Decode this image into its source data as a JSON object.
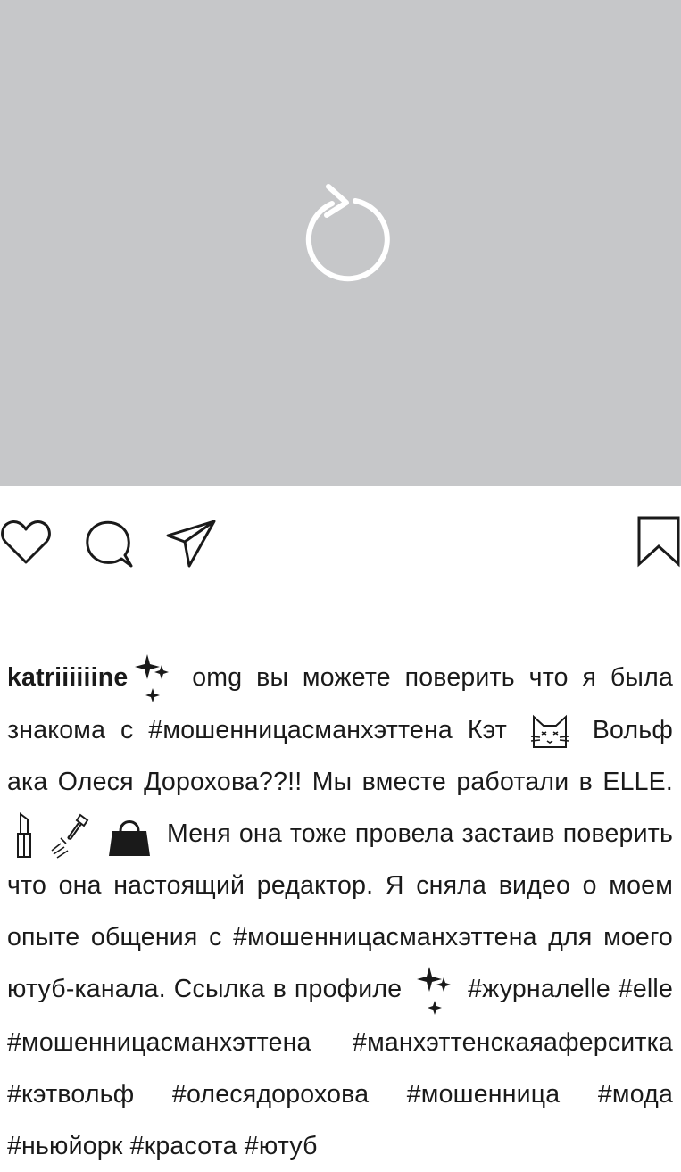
{
  "post": {
    "media": {
      "background": "#c6c7c9",
      "icon": "reload-icon"
    },
    "actions": {
      "like_icon": "heart-outline-icon",
      "comment_icon": "speech-bubble-icon",
      "share_icon": "paper-plane-icon",
      "save_icon": "bookmark-icon"
    },
    "caption": {
      "username": "katriiiiiine",
      "s1": " omg вы можете поверить что я была знакома с ",
      "tag1": "#мошенницасманхэттена",
      "s2": " Кэт ",
      "s3": " Вольф ака Олеся Дорохова??!! Мы вместе работали в ELLE. ",
      "s4": " Меня она тоже провела застаив поверить что она настоящий редактор. Я сняла видео о моем опыте общения с ",
      "tag2": "#мошенницасманхэттена",
      "s5": " для моего ютуб-канала. Ссылка в профиле ",
      "tag3": "#журналelle",
      "tag4": "#elle",
      "tag5": "#мошенницасманхэттена",
      "tag6": "#манхэттенскаяаферситка",
      "tag7": "#кэтвольф",
      "tag8": "#олесядорохова",
      "tag9": "#мошенница",
      "tag10": "#мода",
      "tag11": "#ньюйорк",
      "tag12": "#красота",
      "tag13": "#ютуб",
      "emoji": [
        "sparkles-icon",
        "cat-face-icon",
        "lipstick-icon",
        "nail-polish-icon",
        "handbag-icon",
        "sparkles-icon"
      ]
    }
  }
}
